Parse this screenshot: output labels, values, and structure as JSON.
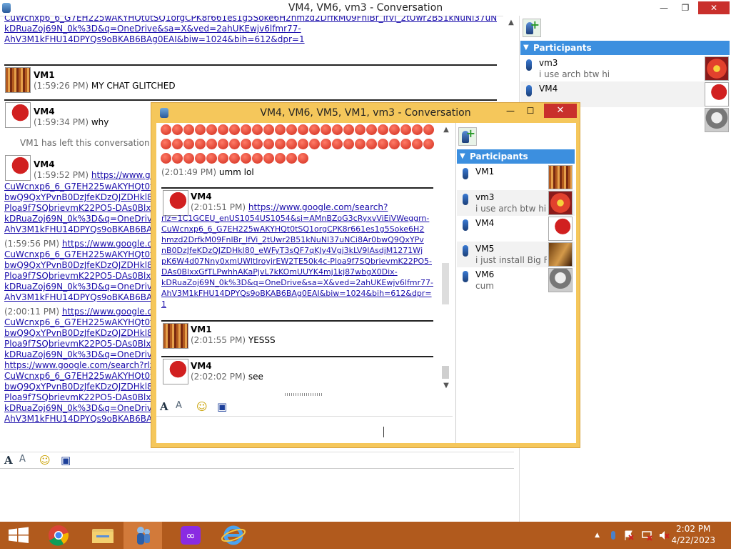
{
  "bg_window": {
    "title": "VM4, VM6, vm3 - Conversation",
    "min_label": "—",
    "max_label": "❐",
    "close_label": "✕",
    "top_link_lines": [
      "CuWcnxp6_6_G7EH225wAKYHQt0tSQ1orgCPK8r661es1g5Soke6H2hmzd2DrfkM09FnlBr_lfVi_2tUwr2B51kNuNl37uNCi8Ar0bwQ9QxYPvnB0DzJfeKDzQJZDHkl80_eWFyT3sQF7qKJy4Vgj3kLV9lAsdjM1271WjpK6W4d07Nny0xmUWltlroyjrEW2TE50k4c-Ploa9f7SQbrievmK22PO5-DAs0BlxxGfTLPwhhAKaPjvL7kKOmUUYK4mj1kj87wbgX0Dix-",
      "kDRuaZoj69N_0k%3D&q=OneDrive&sa=X&ved=2ahUKEwjv6lfmr77-",
      "AhV3M1kFHU14DPYQs9oBKAB6BAg0EAI&biw=1024&bih=612&dpr=1"
    ],
    "messages": [
      {
        "sender": "VM1",
        "time": "(1:59:26 PM)",
        "text": "MY CHAT GLITCHED"
      },
      {
        "sender": "VM4",
        "time": "(1:59:34 PM)",
        "text": "why"
      }
    ],
    "left_notice": "VM1 has left this conversation",
    "vm4_msg2": {
      "sender": "VM4",
      "time": "(1:59:52 PM)",
      "link": "https://www.google.com/search?rlz=1C1GCEU_enUS1054US1054&si="
    },
    "link_lines": [
      "CuWcnxp6_6_G7EH225wAKYHQt0tSQ1orgCPK8r661es1g5Soke6H2",
      "bwQ9QxYPvnB0DzJfeKDzQJZDHkl80_eWFyT3sQF7qKJy4Vgj3kLV9lAsdjM",
      "Ploa9f7SQbrievmK22PO5-DAs0BlxxGfTLPwhhAKaPjvL7kKOmUUYK4m",
      "kDRuaZoj69N_0k%3D&q=OneDrive&sa=X&ved=2ahUKEwjv6lfmr77-",
      "AhV3M1kFHU14DPYQs9oBKAB6BAg0EAI&biw=1024&bih=612&dpr=1"
    ],
    "msg3_time": "(1:59:56 PM)",
    "msg3_link": "https://www.google.com/search?rlz=1C1GCEU_enUS1054US1054&si=",
    "msg4_time": "(2:00:11 PM)",
    "msg4_link": "https://www.google.com/search?rlz=1C1GCEU_enUS1054US1054&si=",
    "extra_link": "https://www.google.com/search?rlz=1C1GCEU_enUS1054US1054&si=",
    "participants_header": "Participants",
    "participants": [
      {
        "name": "vm3",
        "status": "i use arch btw hi"
      },
      {
        "name": "VM4",
        "status": ""
      },
      {
        "name": "",
        "status": ""
      }
    ]
  },
  "fg_window": {
    "title": "VM4, VM6, VM5, VM1, vm3 - Conversation",
    "min_label": "—",
    "max_label": "☐",
    "close_label": "✕",
    "emoji_msg": {
      "time": "(2:01:49 PM)",
      "text": "umm lol"
    },
    "vm4_link_msg": {
      "sender": "VM4",
      "time": "(2:01:51 PM)",
      "link_first": "https://www.google.com/search?",
      "link_lines": [
        "rlz=1C1GCEU_enUS1054US1054&si=AMnBZoG3cRyxvViEiVWeggrn-",
        "CuWcnxp6_6_G7EH225wAKYHQt0tSQ1orgCPK8r661es1g5Soke6H2",
        "hmzd2DrfkM09FnlBr_lfVi_2tUwr2B51kNuNl37uNCi8Ar0bwQ9QxYPv",
        "nB0DzJfeKDzQJZDHkl80_eWFyT3sQF7qKJy4Vgj3kLV9lAsdjM1271Wj",
        "pK6W4d07Nny0xmUWltlroyjrEW2TE50k4c-Ploa9f7SQbrievmK22PO5-",
        "DAs0BlxxGfTLPwhhAKaPjvL7kKOmUUYK4mj1kj87wbgX0Dix-",
        "kDRuaZoj69N_0k%3D&q=OneDrive&sa=X&ved=2ahUKEwjv6lfmr77-",
        "AhV3M1kFHU14DPYQs9oBKAB6BAg0EAI&biw=1024&bih=612&dpr=",
        "1"
      ]
    },
    "vm1_msg": {
      "sender": "VM1",
      "time": "(2:01:55 PM)",
      "text": "YESSS"
    },
    "vm4_msg": {
      "sender": "VM4",
      "time": "(2:02:02 PM)",
      "text": "see"
    },
    "participants_header": "Participants",
    "participants": [
      {
        "name": "VM1",
        "status": ""
      },
      {
        "name": "vm3",
        "status": "i use arch btw hi"
      },
      {
        "name": "VM4",
        "status": ""
      },
      {
        "name": "VM5",
        "status": "i just install Big F..."
      },
      {
        "name": "VM6",
        "status": "cum"
      }
    ]
  },
  "toolbar_glyphs": {
    "font": "A",
    "style": "A",
    "emoticon": "☺",
    "save": "▣"
  },
  "taskbar": {
    "time": "2:02 PM",
    "date": "4/22/2023",
    "tray_arrow": "▲"
  },
  "colors": {
    "titlebar_active": "#f5c75b",
    "close_red": "#c9302c",
    "participants_blue": "#3c8fdf",
    "link_blue": "#1a0dab",
    "taskbar": "#b15a1d"
  }
}
